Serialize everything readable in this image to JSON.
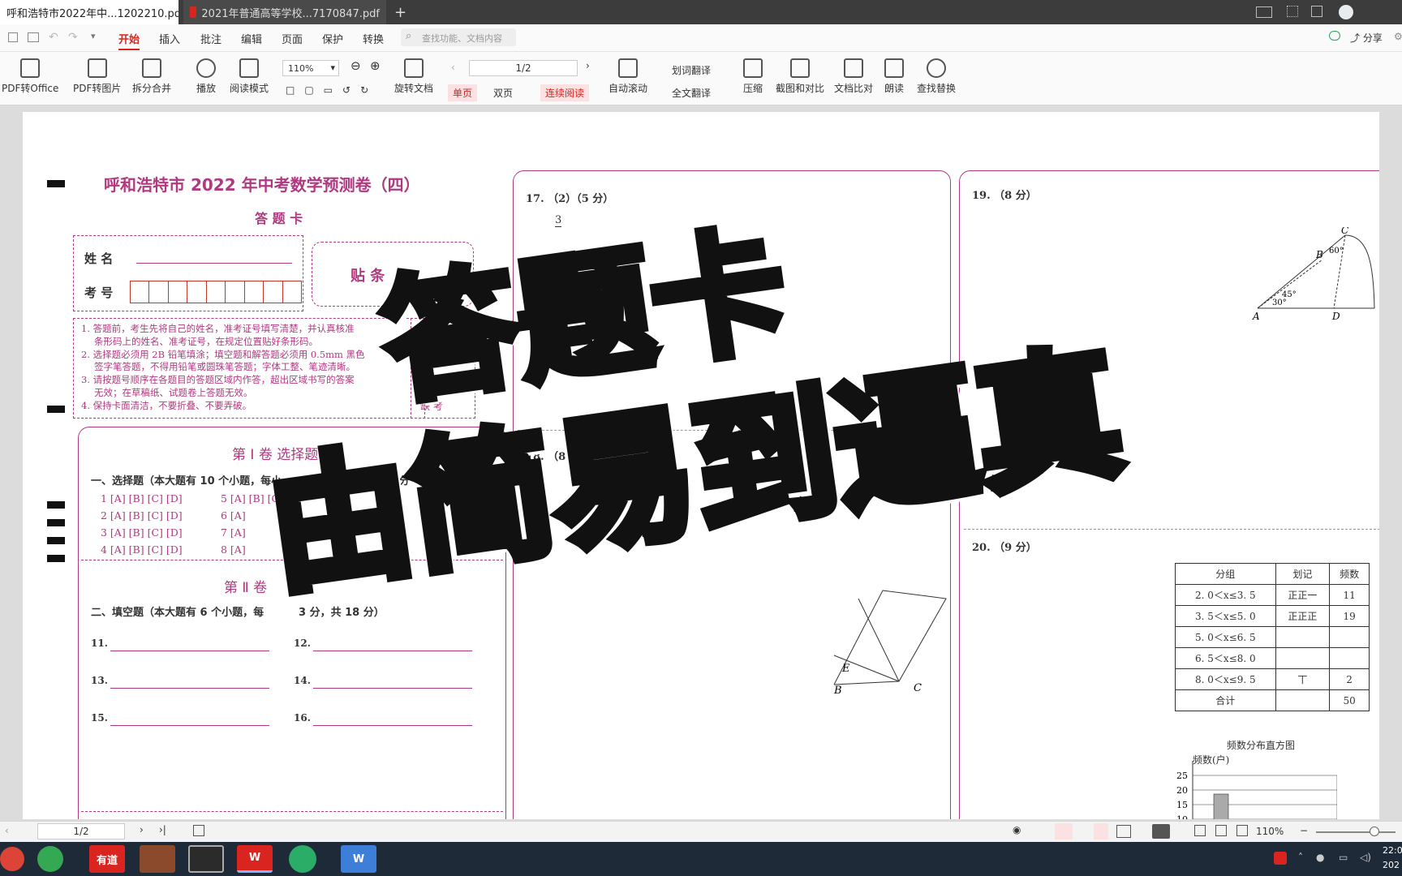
{
  "tabs": [
    {
      "label": "呼和浩特市2022年中...1202210.pdf"
    },
    {
      "label": "2021年普通高等学校...7170847.pdf"
    }
  ],
  "menu": {
    "items": [
      "开始",
      "插入",
      "批注",
      "编辑",
      "页面",
      "保护",
      "转换"
    ],
    "search_placeholder": "查找功能、文档内容",
    "share": "分享"
  },
  "ribbon": {
    "pdf_to_office": "PDF转Office",
    "pdf_to_image": "PDF转图片",
    "split_merge": "拆分合并",
    "play": "播放",
    "read_mode": "阅读模式",
    "zoom": "110%",
    "page": "1/2",
    "rotate": "旋转文档",
    "single": "单页",
    "double": "双页",
    "continuous": "连续阅读",
    "auto_scroll": "自动滚动",
    "word_translate": "划词翻译",
    "full_translate": "全文翻译",
    "compress": "压缩",
    "screenshot": "截图和对比",
    "compare": "文档比对",
    "read_aloud": "朗读",
    "find_replace": "查找替换"
  },
  "doc": {
    "title": "呼和浩特市 2022 年中考数学预测卷（四）",
    "subtitle": "答 题 卡",
    "name_label": "姓  名",
    "id_label": "考  号",
    "barcode": "贴 条",
    "notes": [
      "1. 答题前，考生先将自己的姓名，准考证号填写清楚，并认真核准",
      "条形码上的姓名、准考证号，在规定位置贴好条形码。",
      "2. 选择题必须用 2B 铅笔填涂；填空题和解答题必须用 0.5mm 黑色",
      "签字笔答题，不得用铅笔或圆珠笔答题；字体工整、笔迹清晰。",
      "3. 请按题号顺序在各题目的答题区域内作答，超出区域书写的答案",
      "无效；在草稿纸、试题卷上答题无效。",
      "4. 保持卡面清洁，不要折叠、不要弄破。"
    ],
    "side_note_1": "铅",
    "side_note_2": "缺 考",
    "part1": "第 Ⅰ 卷    选择题",
    "mc_heading": "一、选择题（本大题有 10 个小题，每小",
    "mc_heading_tail": "3 分，共 30 分",
    "mc_rows": [
      "1 [A] [B] [C] [D]",
      "2 [A] [B] [C] [D]",
      "3 [A] [B] [C] [D]",
      "4 [A] [B] [C] [D]"
    ],
    "mc_rows2": [
      "5 [A] [B] [C]",
      "6 [A]",
      "7 [A]",
      "8 [A]"
    ],
    "part2": "第 Ⅱ 卷",
    "fill_heading": "二、填空题（本大题有 6 个小题，每",
    "fill_heading_tail": "3 分，共 18 分）",
    "fill": [
      "11.",
      "12.",
      "13.",
      "14.",
      "15.",
      "16."
    ],
    "q17": "17.  （2）（5 分）",
    "q17_frac": "3",
    "q18": "18.  （8 分）",
    "q19": "19.  （8 分）",
    "q20": "20.  （9 分）",
    "fig19": {
      "C": "C",
      "B": "B",
      "A": "A",
      "D": "D",
      "a60": "60°",
      "a45": "45°",
      "a30": "30°"
    },
    "fig18": {
      "E": "E",
      "B": "B",
      "C": "C"
    },
    "table_header": [
      "分组",
      "划记",
      "频数"
    ],
    "table_rows": [
      [
        "2. 0＜x≤3. 5",
        "正正一",
        "11"
      ],
      [
        "3. 5＜x≤5. 0",
        "正正正",
        "19"
      ],
      [
        "5. 0＜x≤6. 5",
        "",
        ""
      ],
      [
        "6. 5＜x≤8. 0",
        "",
        ""
      ],
      [
        "8. 0＜x≤9. 5",
        "丅",
        "2"
      ],
      [
        "合计",
        "",
        "50"
      ]
    ],
    "hist_title": "频数分布直方图",
    "hist_ylabel": "频数(户)",
    "hist_ticks": [
      "25",
      "20",
      "15",
      "10"
    ]
  },
  "overlay": {
    "line1": "答题卡",
    "line2": "由简易到逼真"
  },
  "status": {
    "page": "1/2",
    "zoom": "110%"
  },
  "taskbar": {
    "youdao": "有道",
    "time": "22:0",
    "date": "202"
  }
}
